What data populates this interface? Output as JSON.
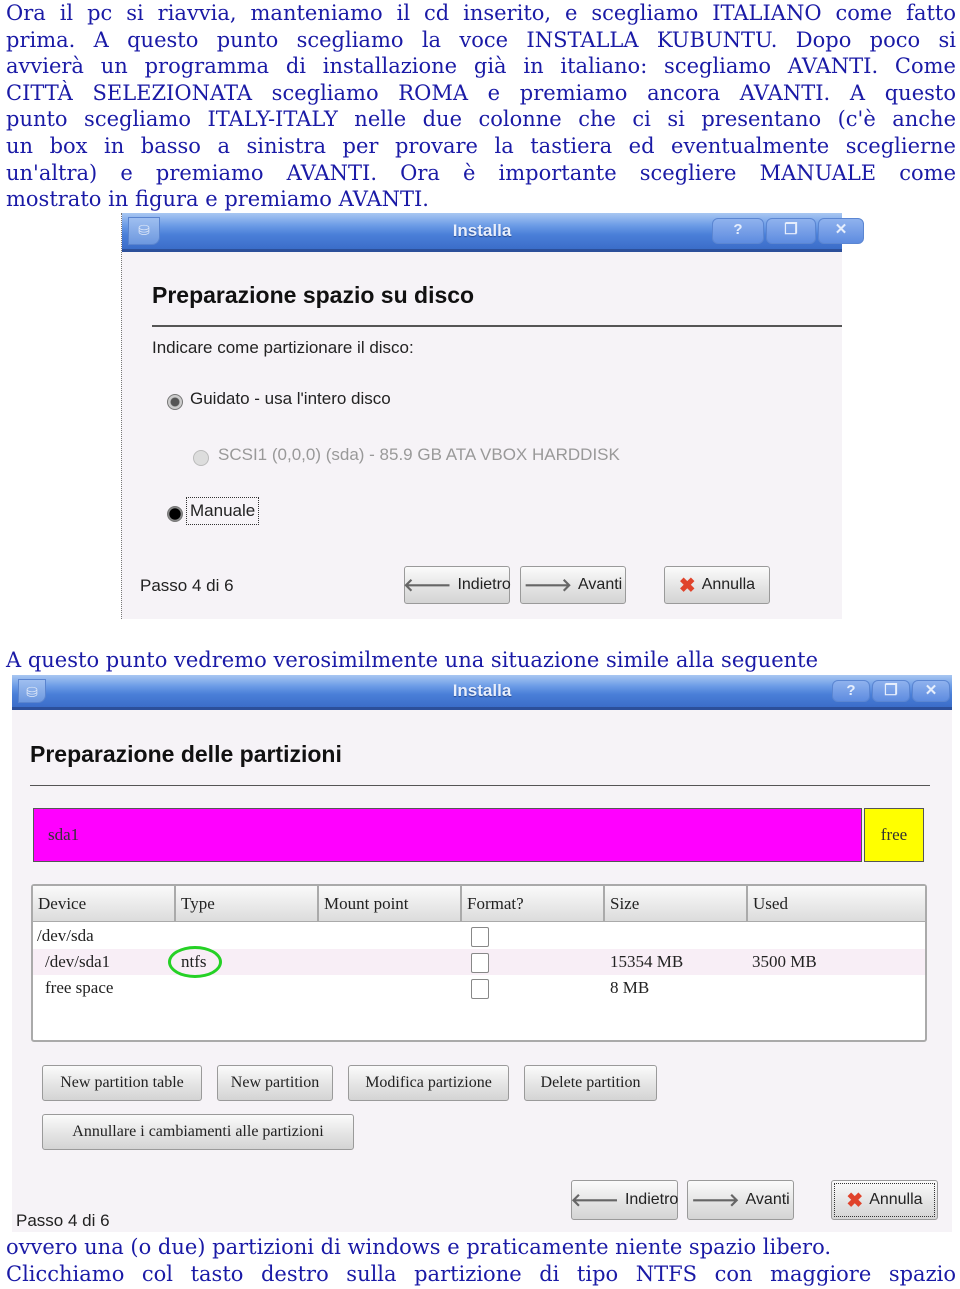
{
  "document": {
    "intro_lines": [
      "Ora il pc si riavvia, manteniamo il cd inserito, e scegliamo ITALIANO come fatto",
      "prima. A questo punto scegliamo la voce INSTALLA KUBUNTU. Dopo poco si",
      "avvierà un programma di installazione già in italiano: scegliamo AVANTI. Come",
      "CITTÀ SELEZIONATA scegliamo ROMA e premiamo ancora AVANTI. A questo",
      "punto scegliamo ITALY-ITALY nelle due colonne che ci si presentano (c'è anche",
      "un box in basso a sinistra per provare la tastiera ed eventualmente sceglierne",
      "un'altra) e premiamo AVANTI. Ora è importante scegliere MANUALE come",
      "mostrato in figura e premiamo AVANTI."
    ],
    "middle_line": "A questo punto vedremo verosimilmente una situazione simile alla seguente",
    "outro_lines": [
      "ovvero una (o due) partizioni di windows e praticamente niente spazio libero.",
      "Clicchiamo col tasto destro sulla partizione di tipo NTFS con maggiore spazio"
    ]
  },
  "window1": {
    "title": "Installa",
    "title_buttons": {
      "help": "?",
      "restore": "❐",
      "close": "✕"
    },
    "app_icon": "installer-icon",
    "heading": "Preparazione spazio su disco",
    "prompt": "Indicare come partizionare il disco:",
    "options": [
      {
        "label": "Guidato - usa l'intero disco",
        "checked": false
      },
      {
        "label": "SCSI1 (0,0,0) (sda) - 85.9 GB ATA VBOX HARDDISK",
        "checked": false,
        "disabled": true
      },
      {
        "label": "Manuale",
        "checked": true
      }
    ],
    "step": "Passo 4 di 6",
    "buttons": {
      "back": "Indietro",
      "next": "Avanti",
      "cancel": "Annulla"
    }
  },
  "window2": {
    "title": "Installa",
    "title_buttons": {
      "help": "?",
      "restore": "❐",
      "close": "✕"
    },
    "heading": "Preparazione delle partizioni",
    "partition_bar": [
      {
        "label": "sda1",
        "color": "#ff00ff"
      },
      {
        "label": "free",
        "color": "#ffff00"
      }
    ],
    "table": {
      "headers": [
        "Device",
        "Type",
        "Mount point",
        "Format?",
        "Size",
        "Used"
      ],
      "rows": [
        {
          "device": "/dev/sda",
          "type": "",
          "mount": "",
          "format": false,
          "size": "",
          "used": ""
        },
        {
          "device": "/dev/sda1",
          "type": "ntfs",
          "mount": "",
          "format": false,
          "size": "15354 MB",
          "used": "3500 MB"
        },
        {
          "device": "free space",
          "type": "",
          "mount": "",
          "format": false,
          "size": "8 MB",
          "used": ""
        }
      ],
      "highlight_color": "#25d125"
    },
    "actions": [
      "New partition table",
      "New partition",
      "Modifica partizione",
      "Delete partition",
      "Annullare i cambiamenti alle partizioni"
    ],
    "step": "Passo 4 di 6",
    "buttons": {
      "back": "Indietro",
      "next": "Avanti",
      "cancel": "Annulla"
    }
  }
}
